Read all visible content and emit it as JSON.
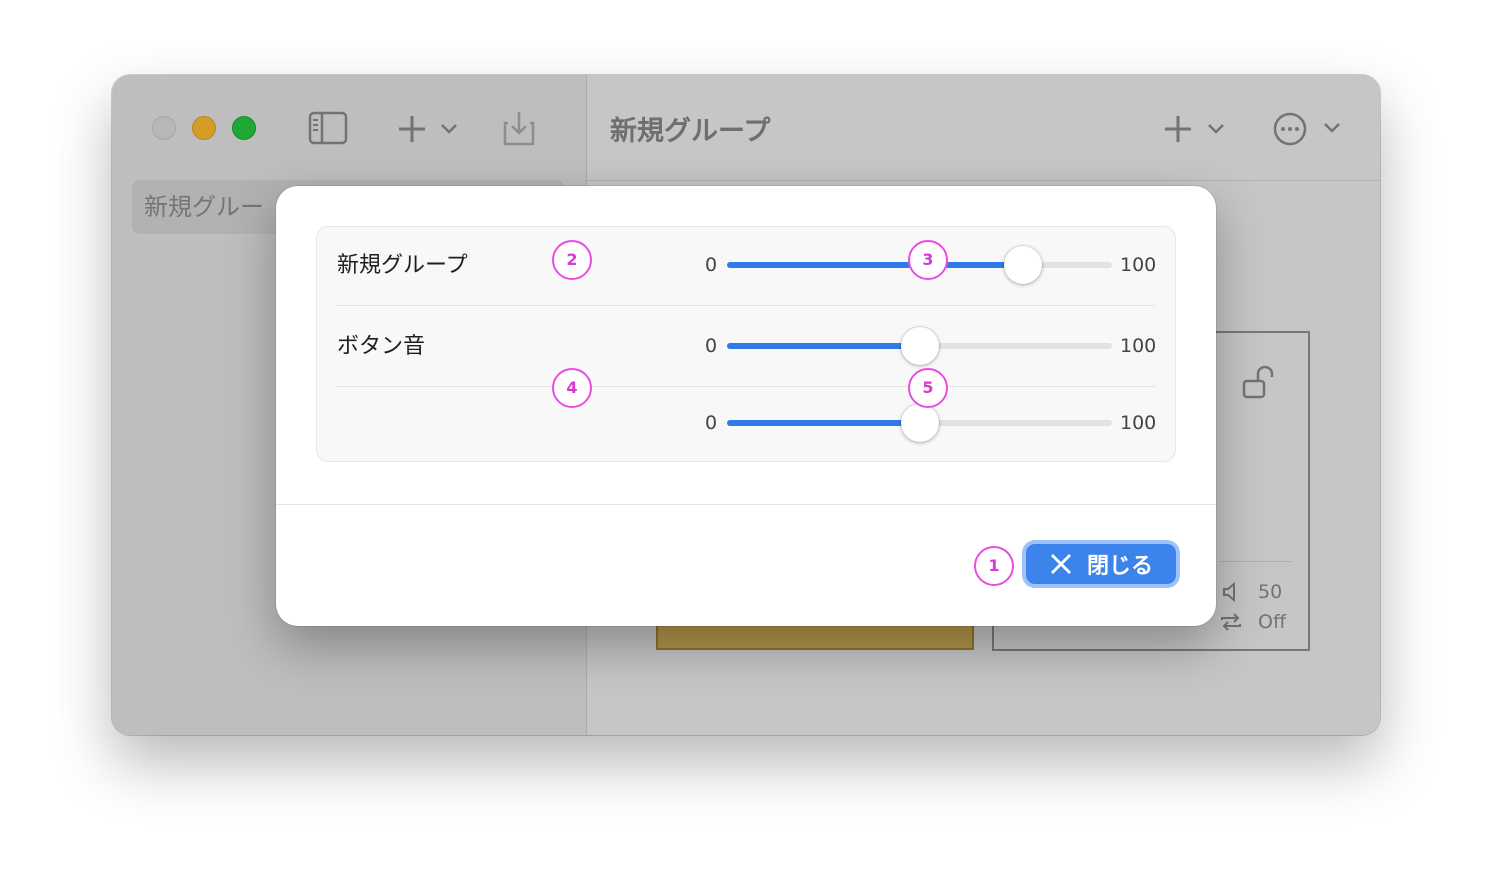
{
  "window": {
    "sidebar_item": "新規グルー",
    "main_title": "新規グループ"
  },
  "background_card": {
    "volume": "50",
    "repeat": "Off"
  },
  "dialog": {
    "rows": [
      {
        "label": "新規グループ",
        "min": "0",
        "max": "100",
        "value": 77
      },
      {
        "label": "ボタン音",
        "min": "0",
        "max": "100",
        "value": 50
      },
      {
        "label": "",
        "min": "0",
        "max": "100",
        "value": 50
      }
    ],
    "close_label": "閉じる"
  },
  "annotations": [
    "1",
    "2",
    "3",
    "4",
    "5"
  ],
  "colors": {
    "accent": "#3c84ec",
    "badge": "#e84de0"
  }
}
